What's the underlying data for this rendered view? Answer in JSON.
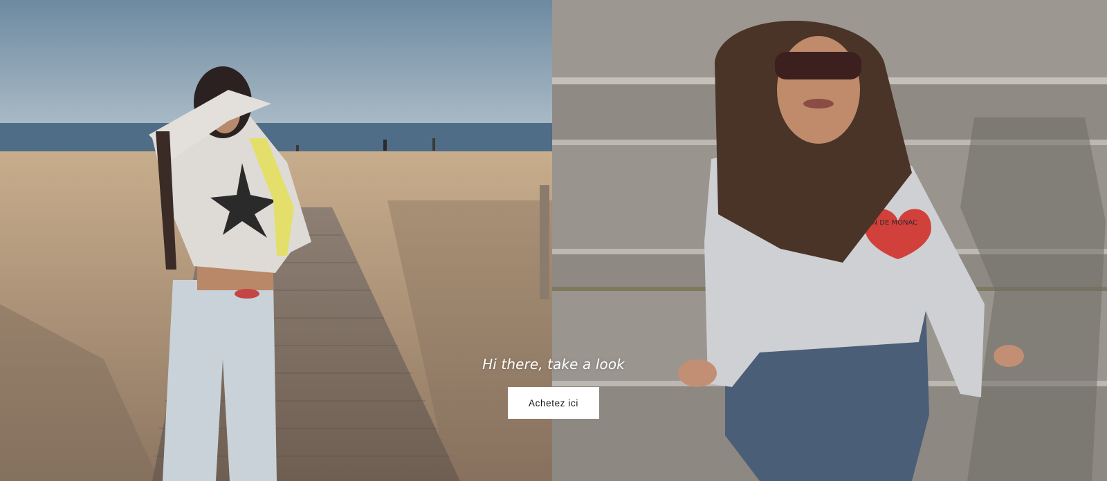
{
  "hero": {
    "subtitle": "Hi there, take a look",
    "cta_label": "Achetez ici",
    "left_image": {
      "scene": "beach-boardwalk-photo"
    },
    "right_image": {
      "scene": "concrete-steps-photo",
      "print_text": "MAISON DE MONAC"
    }
  },
  "colors": {
    "cta_background": "#ffffff",
    "cta_text": "#121212",
    "subtitle_text": "#ffffff"
  }
}
